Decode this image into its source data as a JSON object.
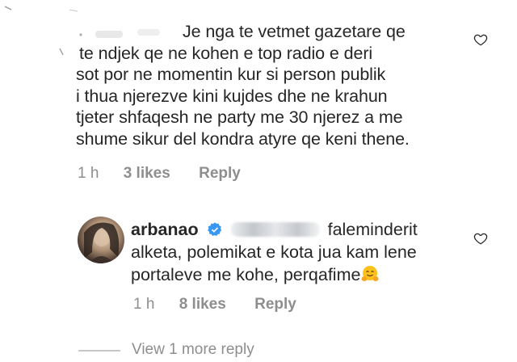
{
  "comment": {
    "text_lines": [
      "Je nga te vetmet gazetare qe",
      "te ndjek qe ne kohen e top radio e deri",
      "sot por ne momentin kur si person publik",
      "i thua njerezve kini kujdes dhe ne krahun",
      "tjeter shfaqesh ne party me 30 njerez a me",
      "shume sikur del kondra atyre qe keni thene."
    ],
    "time": "1 h",
    "likes": "3 likes",
    "reply_label": "Reply"
  },
  "reply": {
    "username": "arbanao",
    "line1_suffix": "faleminderit",
    "line2": "alketa, polemikat e kota jua kam lene",
    "line3": "portaleve me kohe, perqafime",
    "emoji": "hugging-face-emoji",
    "time": "1 h",
    "likes": "8 likes",
    "reply_label": "Reply"
  },
  "view_more": "View 1 more reply",
  "colors": {
    "text": "#262626",
    "meta": "#8e8e8e",
    "verified": "#3897f0",
    "divider": "#c7c7c7"
  },
  "icons": {
    "like_comment": "heart-outline-icon",
    "like_reply": "heart-outline-icon",
    "verified_badge": "verified-badge-icon"
  }
}
